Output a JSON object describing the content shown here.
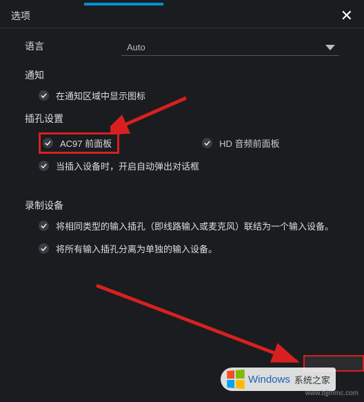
{
  "header": {
    "title": "选项",
    "close_glyph": "✕"
  },
  "language": {
    "label": "语言",
    "selected": "Auto"
  },
  "notification": {
    "label": "通知",
    "show_tray_label": "在通知区域中显示图标"
  },
  "jack": {
    "label": "插孔设置",
    "ac97_label": "AC97 前面板",
    "hd_label": "HD 音频前面板",
    "auto_popup_label": "当插入设备时，开启自动弹出对话框"
  },
  "recording": {
    "label": "录制设备",
    "merge_label": "将相同类型的输入插孔（即线路输入或麦克风）联结为一个输入设备。",
    "split_label": "将所有输入插孔分离为单独的输入设备。"
  },
  "watermark": {
    "brand": "Windows",
    "sub": "系统之家",
    "url": "www.bjjmmc.com"
  }
}
